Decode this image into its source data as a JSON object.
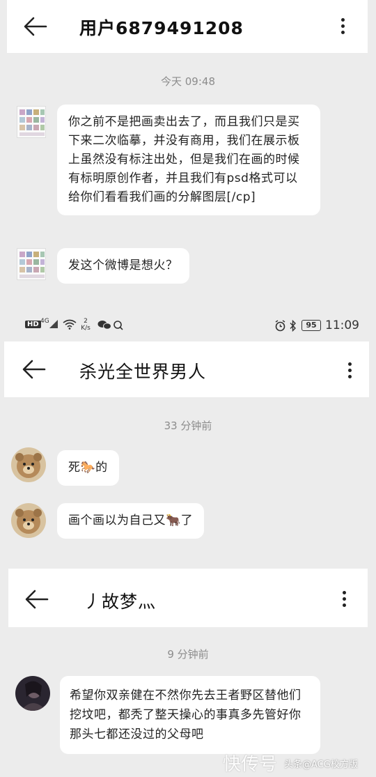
{
  "chat1": {
    "title": "用户6879491208",
    "time": "今天 09:48",
    "messages": [
      "你之前不是把画卖出去了，而且我们只是买下来二次临摹，并没有商用，我们在展示板上虽然没有标注出处，但是我们在画的时候有标明原创作者，并且我们有psd格式可以给你们看看我们画的分解图层[/cp]",
      "发这个微博是想火？"
    ]
  },
  "status_bar": {
    "hd": "HD",
    "net": "4G",
    "speed": "2 K/s",
    "battery": "95",
    "clock": "11:09"
  },
  "chat2": {
    "title": "杀光全世界男人",
    "time": "33 分钟前",
    "messages": [
      "死🐎的",
      "画个画以为自己又🐂了"
    ]
  },
  "chat3": {
    "title": "丿故梦灬",
    "time": "9 分钟前",
    "messages": [
      "希望你双亲健在不然你先去王者野区替他们挖坟吧，都秃了整天操心的事真多先管好你那头七都还没过的父母吧"
    ]
  },
  "watermark": {
    "main": "快传号",
    "sub": "头条@ACG校方版"
  }
}
